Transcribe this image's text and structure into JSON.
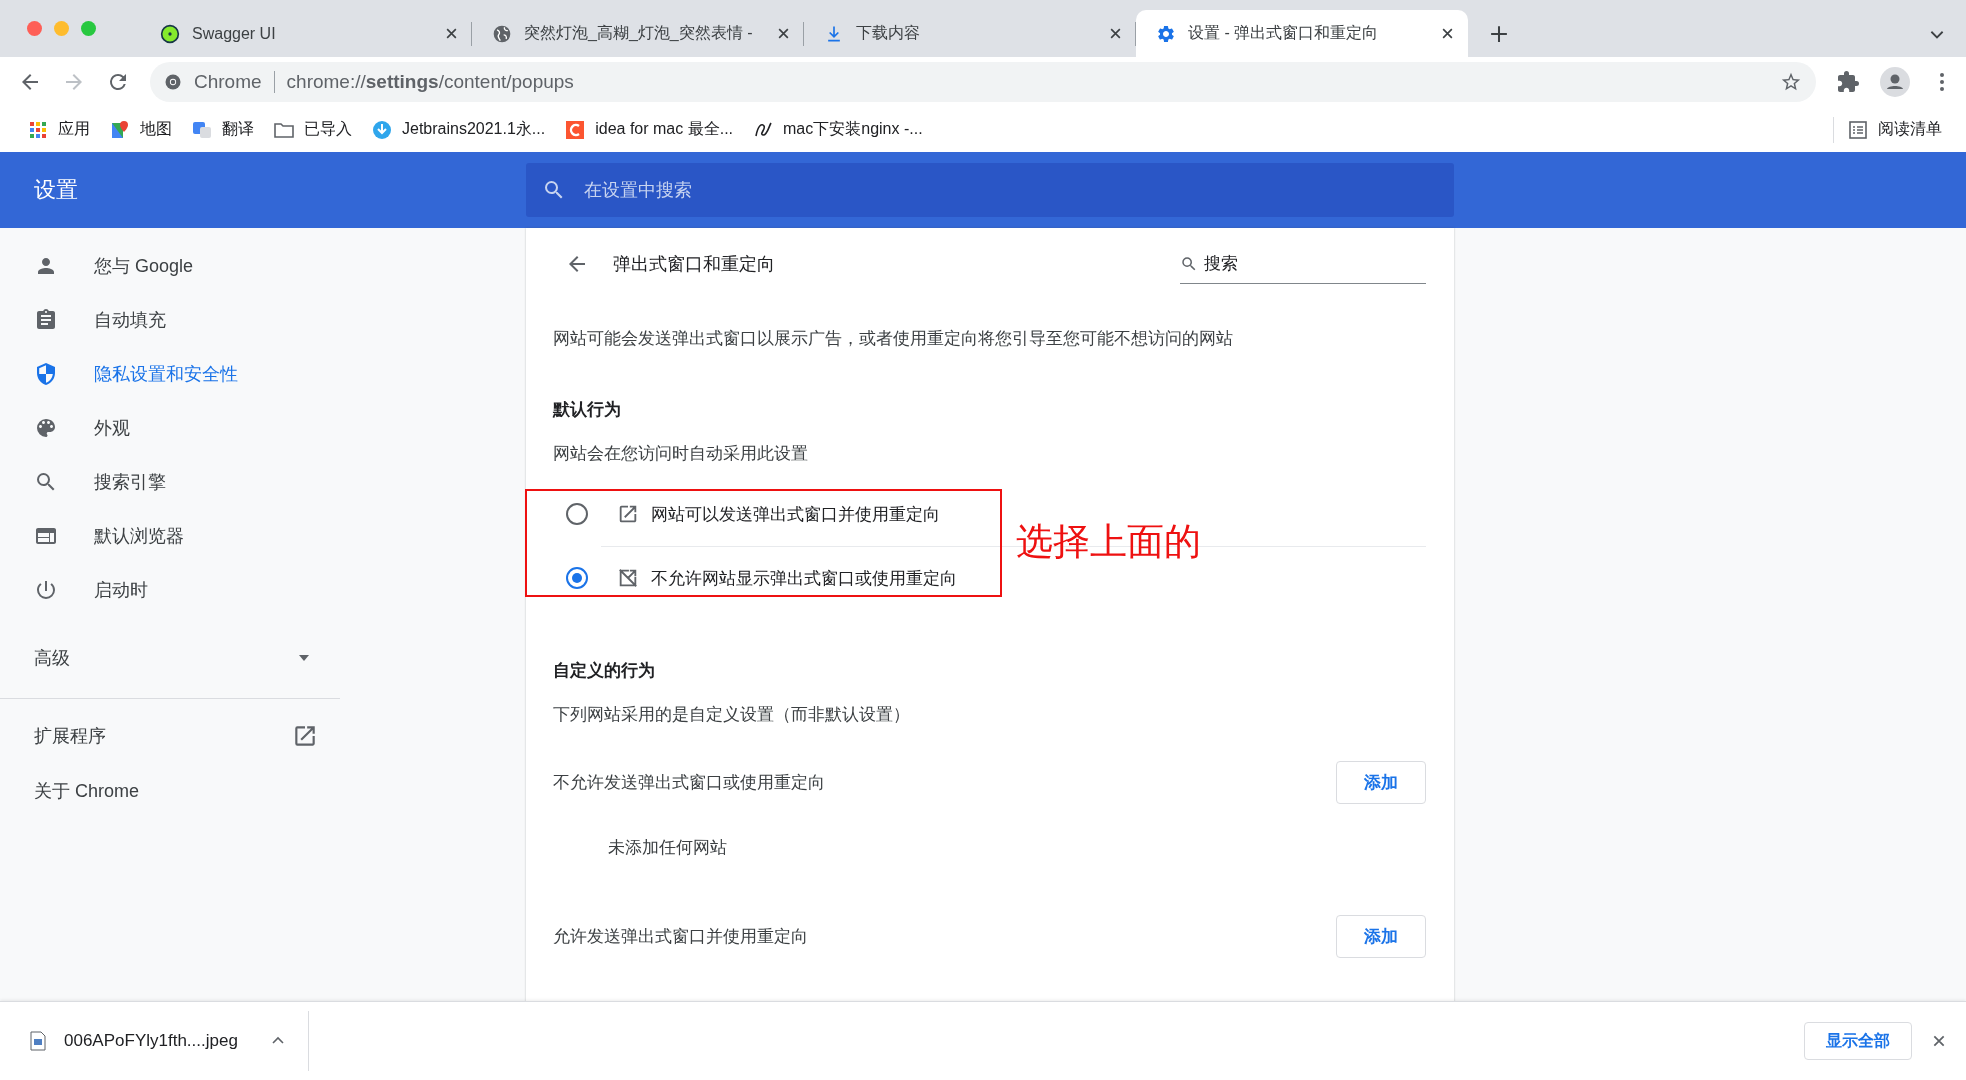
{
  "browser": {
    "tabs": [
      {
        "title": "Swagger UI",
        "selected": false
      },
      {
        "title": "突然灯泡_高糊_灯泡_突然表情 -",
        "selected": false
      },
      {
        "title": "下载内容",
        "selected": false
      },
      {
        "title": "设置 - 弹出式窗口和重定向",
        "selected": true
      }
    ],
    "omnibox": {
      "site": "Chrome",
      "url": "chrome://**settings**/content/popups"
    },
    "bookmarks": [
      {
        "label": "应用"
      },
      {
        "label": "地图"
      },
      {
        "label": "翻译"
      },
      {
        "label": "已导入"
      },
      {
        "label": "Jetbrains2021.1永..."
      },
      {
        "label": "idea for mac 最全..."
      },
      {
        "label": "mac下安装nginx -..."
      }
    ],
    "reading_list": "阅读清单"
  },
  "header": {
    "title": "设置",
    "search": {
      "placeholder": "在设置中搜索"
    }
  },
  "sidebar": {
    "items": [
      {
        "label": "您与 Google",
        "selected": false
      },
      {
        "label": "自动填充",
        "selected": false
      },
      {
        "label": "隐私设置和安全性",
        "selected": true
      },
      {
        "label": "外观",
        "selected": false
      },
      {
        "label": "搜索引擎",
        "selected": false
      },
      {
        "label": "默认浏览器",
        "selected": false
      },
      {
        "label": "启动时",
        "selected": false
      }
    ],
    "advanced": {
      "label": "高级",
      "expanded": false
    },
    "links": [
      {
        "label": "扩展程序"
      },
      {
        "label": "关于 Chrome"
      }
    ]
  },
  "page": {
    "title": "弹出式窗口和重定向",
    "search": {
      "placeholder": "搜索"
    },
    "description": "网站可能会发送弹出式窗口以展示广告，或者使用重定向将您引导至您可能不想访问的网站",
    "default_title": "默认行为",
    "default_subtitle": "网站会在您访问时自动采用此设置",
    "options": [
      {
        "label": "网站可以发送弹出式窗口并使用重定向",
        "selected": false
      },
      {
        "label": "不允许网站显示弹出式窗口或使用重定向",
        "selected": true
      }
    ],
    "custom_title": "自定义的行为",
    "custom_subtitle": "下列网站采用的是自定义设置（而非默认设置）",
    "lists": [
      {
        "title": "不允许发送弹出式窗口或使用重定向",
        "button": "添加",
        "empty": "未添加任何网站"
      },
      {
        "title": "允许发送弹出式窗口并使用重定向",
        "button": "添加"
      }
    ]
  },
  "annotation": {
    "text": "选择上面的"
  },
  "download_bar": {
    "file": "006APoFYly1fth....jpeg",
    "show_all": "显示全部"
  }
}
